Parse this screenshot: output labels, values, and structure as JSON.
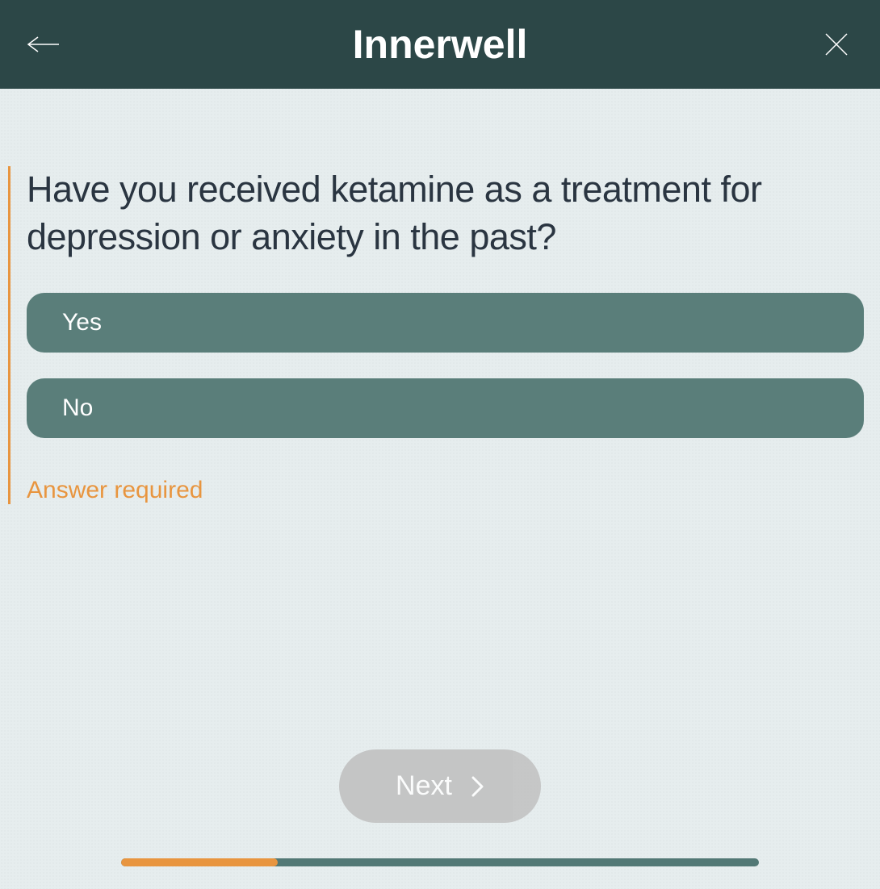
{
  "header": {
    "brand": "Innerwell"
  },
  "question": {
    "text": "Have you received ketamine as a treatment for depression or anxiety in the past?",
    "options": [
      "Yes",
      "No"
    ],
    "validation": "Answer required"
  },
  "footer": {
    "next_label": "Next",
    "progress_percent": 24.5
  },
  "colors": {
    "header_bg": "#2c4747",
    "page_bg": "#e6edee",
    "accent": "#e8953f",
    "option_bg": "#5a7e7a",
    "next_bg": "#bfbfbf",
    "progress_track": "#527875"
  }
}
